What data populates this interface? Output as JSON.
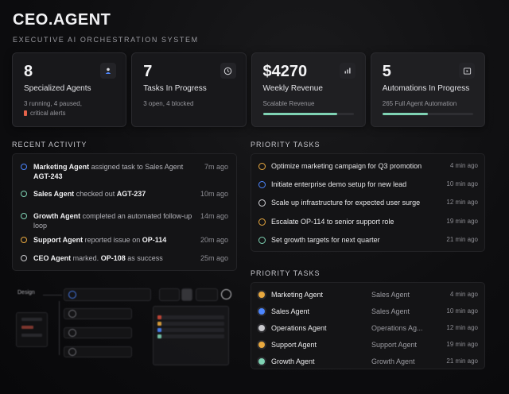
{
  "app": {
    "title": "CEO.AGENT",
    "subtitle": "EXECUTIVE AI ORCHESTRATION SYSTEM"
  },
  "stats": [
    {
      "value": "8",
      "label": "Specialized Agents",
      "detail": "3 running, 4 paused,",
      "alert": "critical alerts",
      "icon": "user-icon"
    },
    {
      "value": "7",
      "label": "Tasks In Progress",
      "detail": "3 open, 4 blocked",
      "icon": "clock-icon"
    },
    {
      "value": "$4270",
      "label": "Weekly Revenue",
      "detail": "Scalable Revenue",
      "icon": "bar-chart-icon",
      "progress": 0.82
    },
    {
      "value": "5",
      "label": "Automations In Progress",
      "detail": "265 Full Agent Automation",
      "icon": "play-icon",
      "progress": 0.5
    }
  ],
  "activity": {
    "title": "RECENT ACTIVITY",
    "items": [
      {
        "agent": "Marketing Agent",
        "text": " assigned task to Sales Agent ",
        "ref": "AGT-243",
        "time": "7m ago",
        "color": "#4c86ff"
      },
      {
        "agent": "Sales Agent",
        "text": " checked out ",
        "ref": "AGT-237",
        "time": "10m ago",
        "color": "#7fd3b4"
      },
      {
        "agent": "Growth Agent",
        "text": " completed an automated follow-up loop",
        "ref": "",
        "time": "14m ago",
        "color": "#7fd3b4"
      },
      {
        "agent": "Support Agent",
        "text": " reported issue on ",
        "ref": "OP-114",
        "time": "20m ago",
        "color": "#e9a93f"
      },
      {
        "agent": "CEO Agent",
        "text": " marked. ",
        "ref": "OP-108",
        "suffix": " as success",
        "time": "25m ago",
        "color": "#c8c8cc"
      }
    ]
  },
  "priority_tasks": {
    "title": "PRIORITY TASKS",
    "items": [
      {
        "name": "Optimize marketing campaign for Q3 promotion",
        "time": "4 min ago",
        "color": "#e9a93f"
      },
      {
        "name": "Initiate enterprise demo setup for new lead",
        "time": "10 min ago",
        "color": "#4c86ff"
      },
      {
        "name": "Scale up infrastructure for expected user surge",
        "time": "12 min ago",
        "color": "#d8d8dc"
      },
      {
        "name": "Escalate OP-114 to senior support role",
        "time": "19 min ago",
        "color": "#e9a93f"
      },
      {
        "name": "Set growth targets for next quarter",
        "time": "21 min ago",
        "color": "#7fd3b4"
      }
    ]
  },
  "agents_tasks": {
    "title": "PRIORITY TASKS",
    "items": [
      {
        "name": "Marketing Agent",
        "role": "Sales Agent",
        "time": "4 min ago",
        "color": "#e9a93f"
      },
      {
        "name": "Sales Agent",
        "role": "Sales Agent",
        "time": "10 min ago",
        "color": "#4c86ff"
      },
      {
        "name": "Operations Agent",
        "role": "Operations Ag...",
        "time": "12 min ago",
        "color": "#c8c8cc"
      },
      {
        "name": "Support Agent",
        "role": "Support Agent",
        "time": "19 min ago",
        "color": "#e9a93f"
      },
      {
        "name": "Growth Agent",
        "role": "Growth Agent",
        "time": "21 min ago",
        "color": "#7fd3b4"
      }
    ]
  },
  "workflow": {
    "label": "Design"
  }
}
